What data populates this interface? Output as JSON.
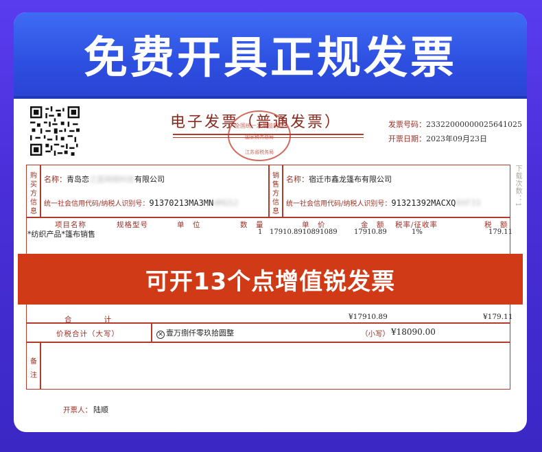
{
  "banner": {
    "title": "免费开具正规发票"
  },
  "invoice": {
    "title": "电子发票（普通发票）",
    "seal_text": "全国统一发票监制章",
    "seal_sub": "国家税务总局",
    "seal_bottom": "江苏省税务局",
    "number_label": "发票号码：",
    "number_value": "23322000000025641025",
    "date_label": "开票日期：",
    "date_value": "2023年09月23日",
    "side_note": "下载次数：1",
    "buyer": {
      "section_label": "购买方信息",
      "name_label": "名称：",
      "name_visible_start": "青岛恋",
      "name_hidden": "之蓝网络科技",
      "name_visible_end": "有限公司",
      "tax_label": "统一社会信用代码/纳税人识别号：",
      "tax_visible": "91370213MA3MN",
      "tax_hidden": "HMG52"
    },
    "seller": {
      "section_label": "销售方信息",
      "name_label": "名称：",
      "name": "宿迁市鑫龙篷布有限公司",
      "tax_label": "统一社会信用代码/纳税人识别号：",
      "tax_visible": "91321392MACXQ",
      "tax_hidden": "8XF33"
    },
    "columns": {
      "item": "项目名称",
      "spec": "规格型号",
      "unit": "单　位",
      "qty": "数　量",
      "price": "单　价",
      "amount": "金　额",
      "rate": "税率/征收率",
      "tax": "税　额"
    },
    "row": {
      "item": "*纺织产品*篷布销售",
      "qty": "1",
      "price": "17910.8910891089",
      "amount": "17910.89",
      "rate": "1%",
      "tax": "179.11"
    },
    "total": {
      "label": "合　　　　计",
      "amount": "¥17910.89",
      "tax": "¥179.11"
    },
    "grand_total": {
      "label": "价税合计（大写）",
      "upper_icon": "circle-x-icon",
      "upper": "壹万捌仟零玖拾圆整",
      "lower_label": "（小写）",
      "lower": "¥18090.00"
    },
    "remarks": {
      "label": "备注"
    },
    "issuer": {
      "label": "开票人：",
      "name": "陆顺"
    }
  },
  "promo": {
    "text": "可开13个点增值锐发票"
  }
}
